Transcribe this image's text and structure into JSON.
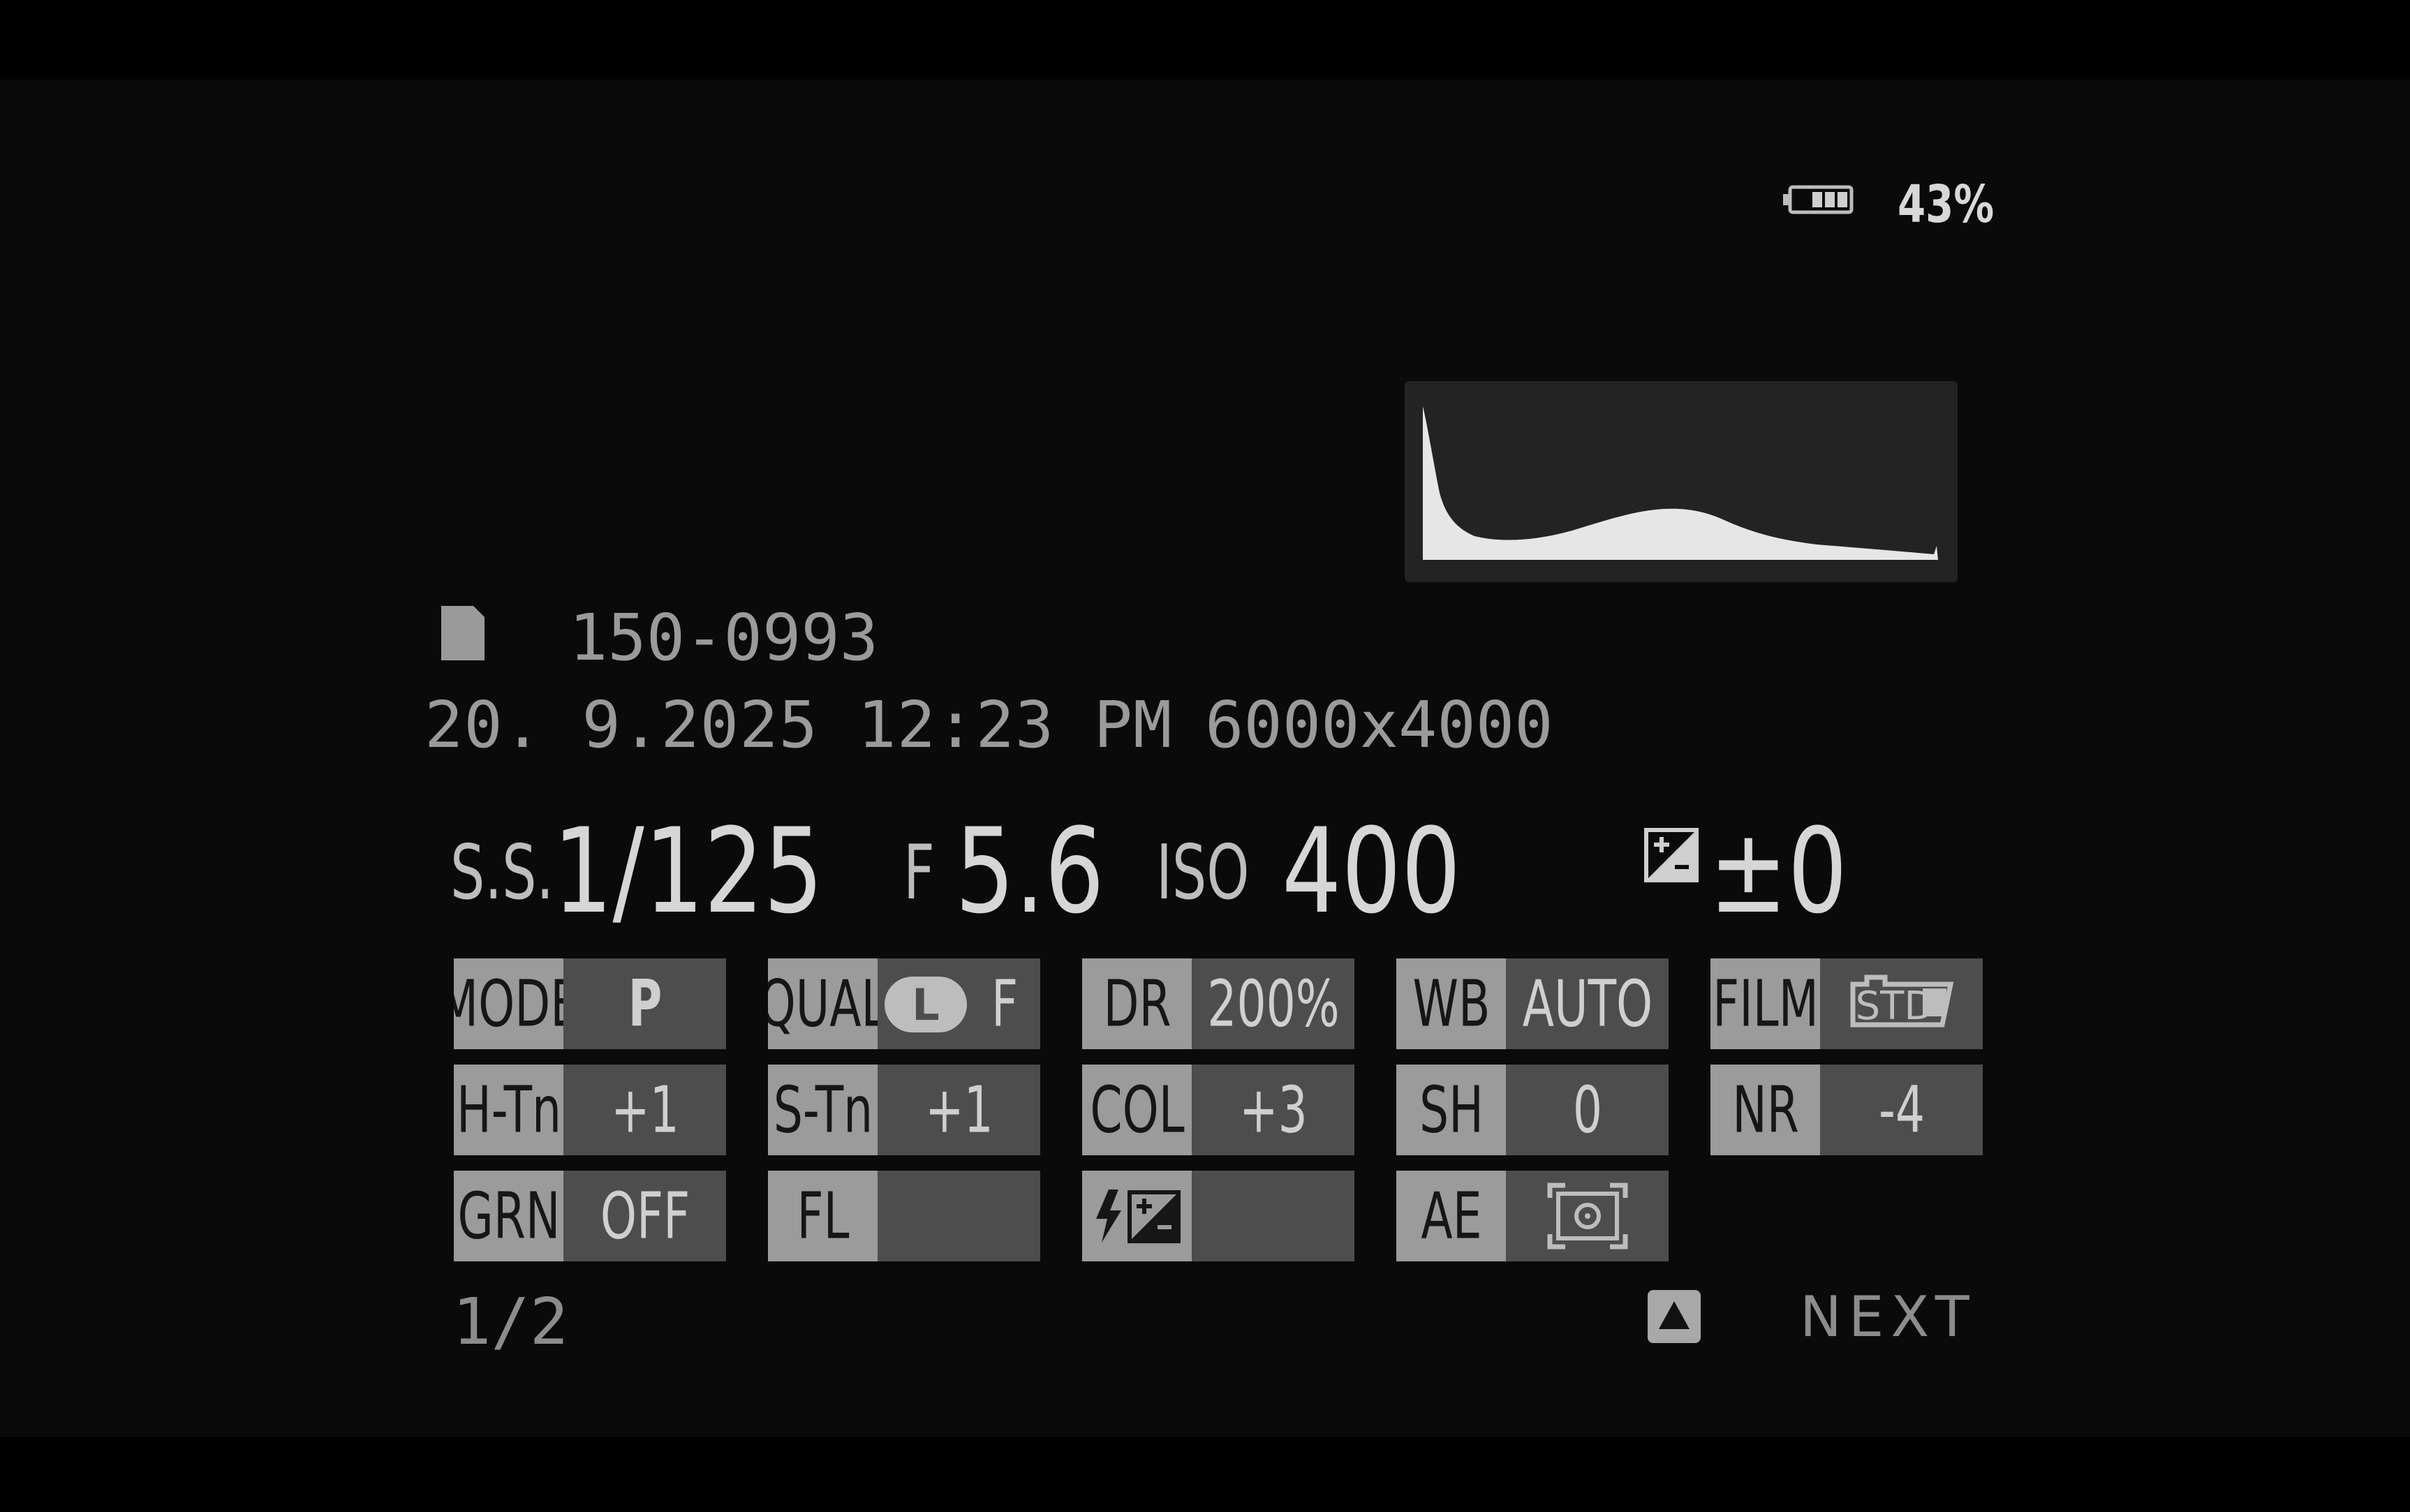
{
  "status": {
    "battery_icon": "battery-icon",
    "battery_percent": "43%",
    "battery_level": 0.43
  },
  "histogram_icon": "luminance-histogram",
  "file": {
    "card_icon": "sd-card-icon",
    "number": "150-0993",
    "datetime": "20. 9.2025 12:23 PM",
    "size": "6000x4000"
  },
  "exposure": {
    "shutter_label": "S.S.",
    "shutter_value": "1/125",
    "aperture_label": "F",
    "aperture_value": "5.6",
    "iso_label": "ISO",
    "iso_value": "400",
    "ev_icon": "exposure-compensation-icon",
    "ev_value": "±0"
  },
  "settings": {
    "mode": {
      "label": "MODE",
      "value": "P"
    },
    "qual": {
      "label": "QUAL",
      "value": "F",
      "icon": "large-size-icon",
      "icon_letter": "L"
    },
    "dr": {
      "label": "DR",
      "value": "200%"
    },
    "wb": {
      "label": "WB",
      "value": "AUTO"
    },
    "film": {
      "label": "FILM",
      "value": "STD",
      "icon": "film-simulation-std-icon"
    },
    "htn": {
      "label": "H-Tn",
      "value": "+1"
    },
    "stn": {
      "label": "S-Tn",
      "value": "+1"
    },
    "col": {
      "label": "COL",
      "value": "+3"
    },
    "sh": {
      "label": "SH",
      "value": "0"
    },
    "nr": {
      "label": "NR",
      "value": "-4"
    },
    "grn": {
      "label": "GRN",
      "value": "OFF"
    },
    "fl": {
      "label": "FL",
      "value": ""
    },
    "flash_ev": {
      "icon": "flash-compensation-icon",
      "value": ""
    },
    "ae": {
      "label": "AE",
      "icon": "multi-metering-icon"
    }
  },
  "footer": {
    "page": "1/2",
    "up_icon": "triangle-up-icon",
    "next_label": "NEXT"
  },
  "colors": {
    "background": "#0a0a0a",
    "label_cell": "#9b9b9b",
    "value_cell": "#4d4d4d",
    "text_primary": "#d6d6d6",
    "text_secondary": "#9a9a9a"
  }
}
